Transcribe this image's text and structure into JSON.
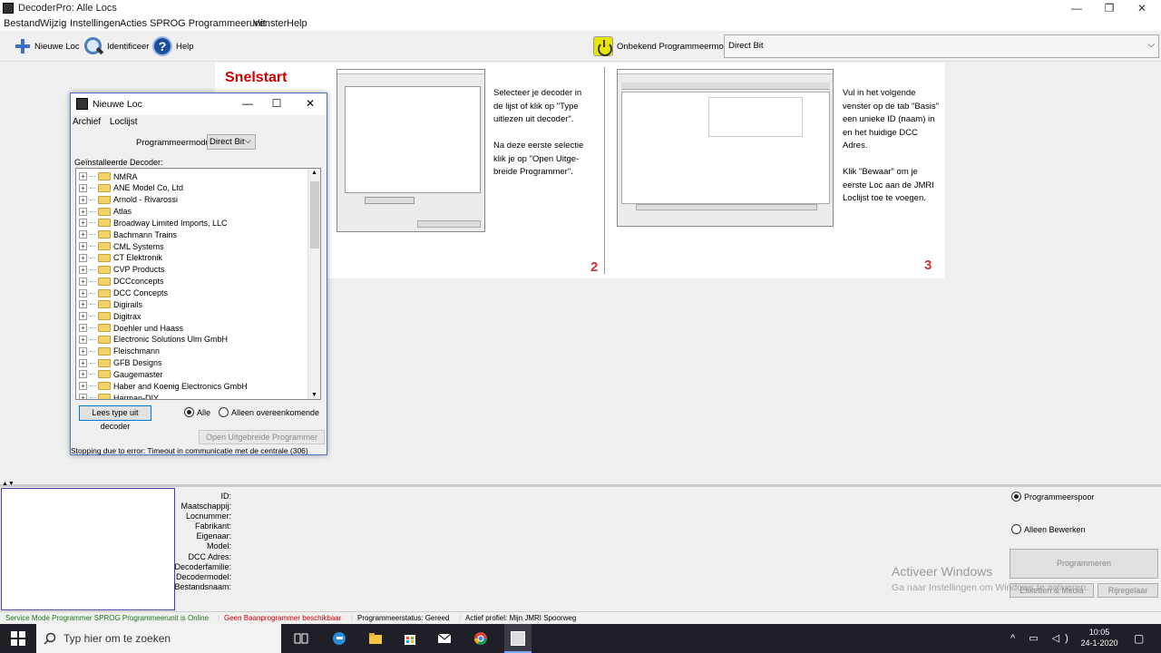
{
  "window": {
    "title": "DecoderPro: Alle Locs"
  },
  "menubar": [
    "Bestand",
    "Wijzig",
    "Instellingen",
    "Acties",
    "SPROG Programmeerunit",
    "Venster",
    "Help"
  ],
  "toolbar": {
    "new_loc": "Nieuwe Loc",
    "identify": "Identificeer",
    "help": "Help",
    "prog_mode_label": "Onbekend Programmeermodus",
    "prog_mode_value": "Direct Bit"
  },
  "quickstart": {
    "title": "Snelstart",
    "step2_text": "Selecteer je decoder in de lijst of klik op \"Type uitlezen uit decoder\".\n\nNa deze eerste selectie klik je op \"Open Uitge-breide Programmer\".",
    "step2_number": "2",
    "step3_text": "Vul in het volgende venster op de tab \"Basis\" een unieke ID (naam) in en het huidige DCC Adres.\n\nKlik \"Bewaar\" om je eerste Loc aan de JMRI Loclijst toe te voegen.",
    "step3_number": "3"
  },
  "dialog": {
    "title": "Nieuwe Loc",
    "menu": [
      "Archief",
      "Loclijst"
    ],
    "prog_mode_label": "Programmeermodus",
    "prog_mode_value": "Direct Bit",
    "installed_label": "Geïnstalleerde Decoder:",
    "decoders": [
      "NMRA",
      "ANE Model Co, Ltd",
      "Arnold - Rivarossi",
      "Atlas",
      "Broadway Limited Imports, LLC",
      "Bachmann Trains",
      "CML Systems",
      "CT Elektronik",
      "CVP Products",
      "DCCconcepts",
      "DCC Concepts",
      "Digirails",
      "Digitrax",
      "Doehler und Haass",
      "Electronic Solutions Ulm GmbH",
      "Fleischmann",
      "GFB Designs",
      "Gaugemaster",
      "Haber and Koenig Electronics GmbH",
      "Harman-DIY"
    ],
    "read_type_button": "Lees type uit decoder",
    "radio_all": "Alle",
    "radio_matching": "Alleen overeenkomende",
    "open_button": "Open Uitgebreide Programmer",
    "status": "Stopping due to error: Timeout in communicatie met de centrale (306)"
  },
  "roster_fields": [
    "ID:",
    "Maatschappij:",
    "Locnummer:",
    "Fabrikant:",
    "Eigenaar:",
    "Model:",
    "DCC Adres:",
    "Decoderfamilie:",
    "Decodermodel:",
    "Bestandsnaam:"
  ],
  "right_panel": {
    "radio_track": "Programmeerspoor",
    "radio_edit": "Alleen Bewerken",
    "program_button": "Programmeren",
    "labels_button": "Etiketten & Media",
    "throttle_button": "Rijregelaar"
  },
  "watermark": {
    "line1": "Activeer Windows",
    "line2": "Ga naar Instellingen om Windows te activeren."
  },
  "statusbar": {
    "service": "Service Mode Programmer SPROG Programmeerunit is Online",
    "ops": "Geen Baanprogrammer beschikbaar",
    "prog_status": "Programmeerstatus: Gereed",
    "profile": "Actief profiel: Mijn JMRI Spoorweg"
  },
  "taskbar": {
    "search": "Typ hier om te zoeken",
    "time": "10:05",
    "date": "24-1-2020"
  },
  "colors": {
    "accent": "#4a74c9",
    "step_number": "#cc3333",
    "quickstart_title": "#cc0000",
    "status_green": "#1a7a1a",
    "status_red": "#cc0000"
  }
}
